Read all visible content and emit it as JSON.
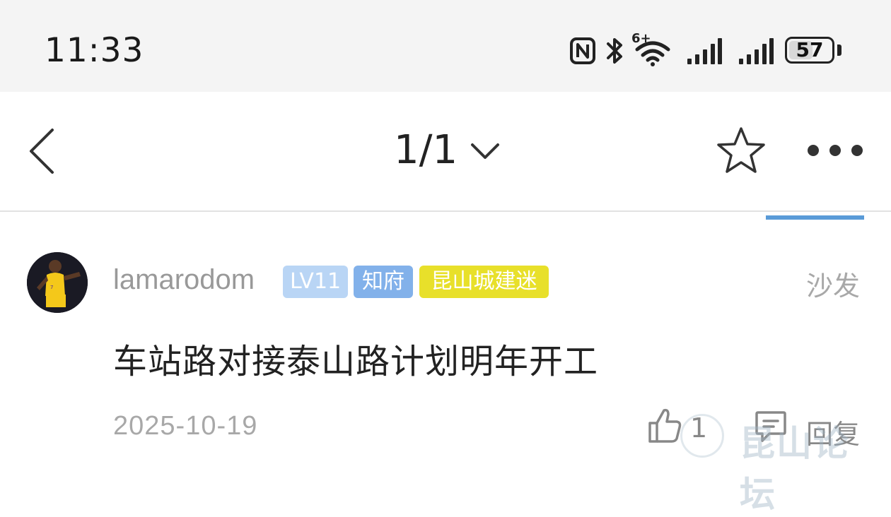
{
  "status_bar": {
    "time": "11:33",
    "battery": "57",
    "battery_level_percent": 57,
    "network_label": "6+"
  },
  "nav": {
    "page_indicator": "1/1"
  },
  "post": {
    "username": "lamarodom",
    "level_badge": "LV11",
    "title_badge": "知府",
    "honor_badge": "昆山城建迷",
    "floor_label": "沙发",
    "body": "车站路对接泰山路计划明年开工",
    "date": "2025-10-19",
    "like_count": "1",
    "reply_label": "回复"
  },
  "watermark": {
    "text": "昆山论坛"
  },
  "colors": {
    "accent": "#5a9bd8",
    "level_badge": "#b9d5f5",
    "title_badge": "#82b1ea",
    "honor_badge": "#e8e02a"
  },
  "icons": [
    "nfc-icon",
    "bluetooth-icon",
    "wifi-icon",
    "signal-icon",
    "battery-icon",
    "back-icon",
    "chevron-down-icon",
    "star-icon",
    "more-icon",
    "thumbs-up-icon",
    "reply-icon"
  ]
}
